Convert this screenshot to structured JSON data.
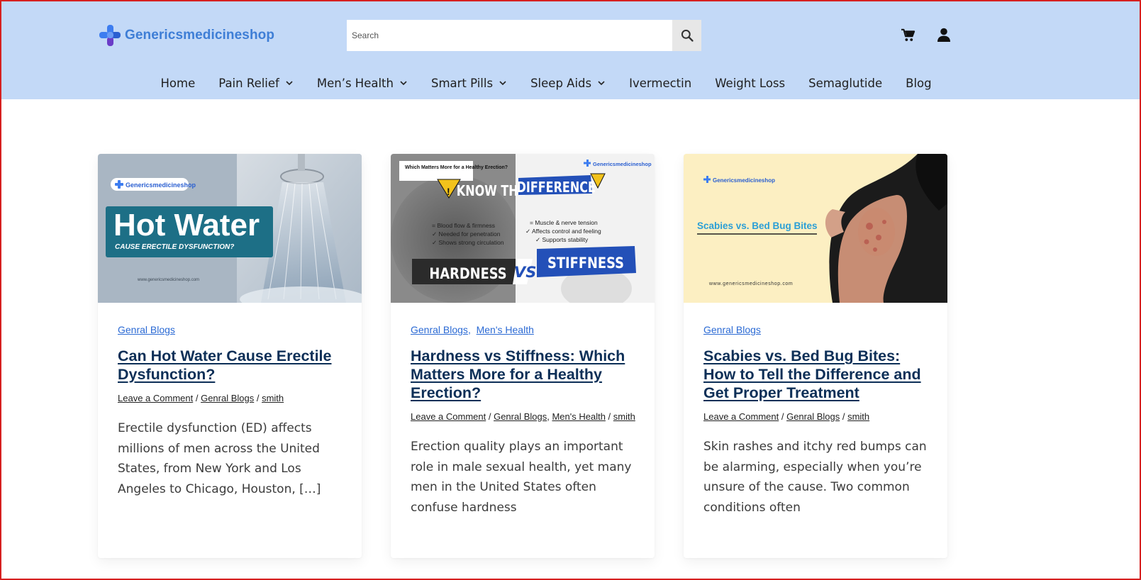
{
  "header": {
    "logo_text": "Genericsmedicineshop",
    "search_placeholder": "Search"
  },
  "nav": [
    {
      "label": "Home",
      "dropdown": false
    },
    {
      "label": "Pain Relief",
      "dropdown": true
    },
    {
      "label": "Men’s Health",
      "dropdown": true
    },
    {
      "label": "Smart Pills",
      "dropdown": true
    },
    {
      "label": "Sleep Aids",
      "dropdown": true
    },
    {
      "label": "Ivermectin",
      "dropdown": false
    },
    {
      "label": "Weight Loss",
      "dropdown": false
    },
    {
      "label": "Semaglutide",
      "dropdown": false
    },
    {
      "label": "Blog",
      "dropdown": false
    }
  ],
  "colors": {
    "header_bg": "#c3d9f7",
    "accent_link": "#2b6ad4",
    "title": "#0d2f57",
    "frame_border": "#d62020"
  },
  "posts": [
    {
      "image": {
        "brand": "Genericsmedicineshop",
        "headline": "Hot Water",
        "subhead": "CAUSE ERECTILE DYSFUNCTION?",
        "url": "www.genericsmedicineshop.com"
      },
      "categories": [
        "Genral Blogs"
      ],
      "title": "Can Hot Water Cause Erectile Dysfunction?",
      "meta": {
        "comment": "Leave a Comment",
        "categories": [
          "Genral Blogs"
        ],
        "author": "smith"
      },
      "excerpt": "Erectile dysfunction (ED) affects millions of men across the United States, from New York and Los Angeles to Chicago, Houston, […]"
    },
    {
      "image": {
        "brand": "Genericsmedicineshop",
        "question": "Which Matters More for a Healthy Erection?",
        "banner_left": "KNOW THE",
        "banner_right": "DIFFERENCE",
        "left_points": [
          "= Blood flow & firmness",
          "✓ Needed for penetration",
          "✓ Shows strong circulation"
        ],
        "right_points": [
          "= Muscle & nerve tension",
          "✓ Affects control and feeling",
          "✓ Supports stability"
        ],
        "left_label": "HARDNESS",
        "vs": "VS",
        "right_label": "STIFFNESS"
      },
      "categories": [
        "Genral Blogs",
        "Men's Health"
      ],
      "title": "Hardness vs Stiffness: Which Matters More for a Healthy Erection?",
      "meta": {
        "comment": "Leave a Comment",
        "categories": [
          "Genral Blogs",
          "Men's Health"
        ],
        "author": "smith"
      },
      "excerpt": "Erection quality plays an important role in male sexual health, yet many men in the United States often confuse hardness"
    },
    {
      "image": {
        "brand": "Genericsmedicineshop",
        "headline": "Scabies vs. Bed Bug Bites",
        "url": "www.genericsmedicineshop.com"
      },
      "categories": [
        "Genral Blogs"
      ],
      "title": "Scabies vs. Bed Bug Bites: How to Tell the Difference and Get Proper Treatment",
      "meta": {
        "comment": "Leave a Comment",
        "categories": [
          "Genral Blogs"
        ],
        "author": "smith"
      },
      "excerpt": "Skin rashes and itchy red bumps can be alarming, especially when you’re unsure of the cause. Two common conditions often"
    }
  ]
}
